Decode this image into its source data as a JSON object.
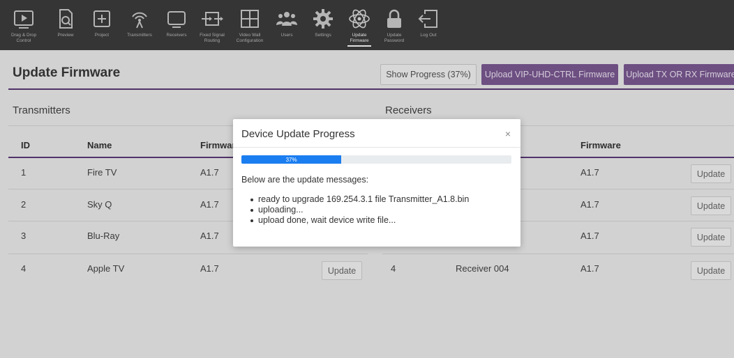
{
  "nav": {
    "items": [
      {
        "label": "Drag & Drop\nControl",
        "icon": "play-screen-icon"
      },
      {
        "label": "Preview",
        "icon": "search-document-icon"
      },
      {
        "label": "Project",
        "icon": "plus-box-icon"
      },
      {
        "label": "Transmitters",
        "icon": "antenna-icon"
      },
      {
        "label": "Receivers",
        "icon": "monitor-icon"
      },
      {
        "label": "Fixed Signal\nRouting",
        "icon": "routing-icon"
      },
      {
        "label": "Video Wall\nConfiguration",
        "icon": "grid-icon"
      },
      {
        "label": "Users",
        "icon": "users-icon"
      },
      {
        "label": "Settings",
        "icon": "gear-icon"
      },
      {
        "label": "Update\nFirmware",
        "icon": "atom-icon",
        "active": true
      },
      {
        "label": "Update\nPassword",
        "icon": "lock-icon"
      },
      {
        "label": "Log Out",
        "icon": "logout-icon"
      }
    ]
  },
  "header": {
    "title": "Update Firmware",
    "show_progress_label": "Show Progress (37%)",
    "upload_ctrl_label": "Upload VIP-UHD-CTRL Firmware",
    "upload_txrx_label": "Upload TX OR RX Firmware"
  },
  "transmitters": {
    "title": "Transmitters",
    "columns": [
      "ID",
      "Name",
      "Firmware"
    ],
    "rows": [
      {
        "id": "1",
        "name": "Fire TV",
        "firmware": "A1.7"
      },
      {
        "id": "2",
        "name": "Sky Q",
        "firmware": "A1.7"
      },
      {
        "id": "3",
        "name": "Blu-Ray",
        "firmware": "A1.7"
      },
      {
        "id": "4",
        "name": "Apple TV",
        "firmware": "A1.7"
      }
    ],
    "update_label": "Update"
  },
  "receivers": {
    "title": "Receivers",
    "columns": [
      "Firmware"
    ],
    "rows": [
      {
        "id": "",
        "name": "",
        "firmware": "A1.7"
      },
      {
        "id": "",
        "name": "",
        "firmware": "A1.7"
      },
      {
        "id": "",
        "name": "",
        "firmware": "A1.7"
      },
      {
        "id": "4",
        "name": "Receiver 004",
        "firmware": "A1.7"
      }
    ],
    "update_label": "Update"
  },
  "modal": {
    "title": "Device Update Progress",
    "close_symbol": "×",
    "progress_value": 37,
    "progress_text": "37%",
    "intro": "Below are the update messages:",
    "messages": [
      "ready to upgrade 169.254.3.1 file Transmitter_A1.8.bin",
      "uploading...",
      "upload done, wait device write file..."
    ]
  },
  "colors": {
    "accent_purple": "#7d5b95",
    "nav_bg": "#3d3d3d",
    "progress_blue": "#1a7df0"
  }
}
